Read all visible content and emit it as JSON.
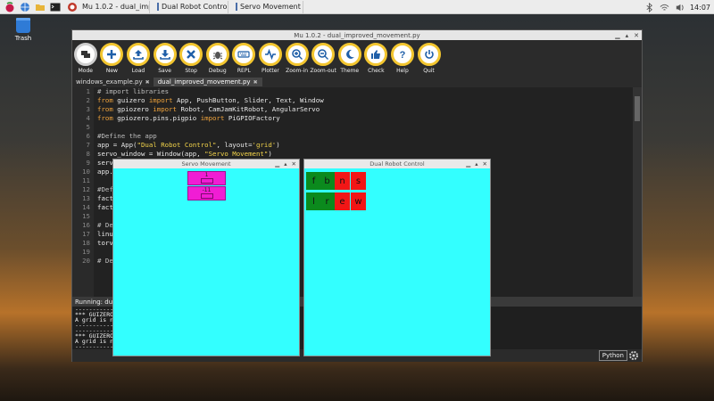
{
  "taskbar": {
    "tasks": [
      {
        "label": "Mu 1.0.2 - dual_impr..."
      },
      {
        "label": "Dual Robot Control"
      },
      {
        "label": "Servo Movement"
      }
    ],
    "clock": "14:07"
  },
  "desktop": {
    "trash_label": "Trash"
  },
  "mu": {
    "title": "Mu 1.0.2 - dual_improved_movement.py",
    "toolbar": [
      {
        "label": "Mode",
        "icon": "mode-icon"
      },
      {
        "label": "New",
        "icon": "plus-icon"
      },
      {
        "label": "Load",
        "icon": "upload-icon"
      },
      {
        "label": "Save",
        "icon": "download-icon"
      },
      {
        "label": "Stop",
        "icon": "close-icon"
      },
      {
        "label": "Debug",
        "icon": "bug-icon"
      },
      {
        "label": "REPL",
        "icon": "keyboard-icon"
      },
      {
        "label": "Plotter",
        "icon": "pulse-icon"
      },
      {
        "label": "Zoom-in",
        "icon": "zoom-in-icon"
      },
      {
        "label": "Zoom-out",
        "icon": "zoom-out-icon"
      },
      {
        "label": "Theme",
        "icon": "moon-icon"
      },
      {
        "label": "Check",
        "icon": "thumbs-up-icon"
      },
      {
        "label": "Help",
        "icon": "question-icon"
      },
      {
        "label": "Quit",
        "icon": "power-icon"
      }
    ],
    "tabs": [
      {
        "label": "windows_example.py"
      },
      {
        "label": "dual_improved_movement.py",
        "active": true
      }
    ],
    "line_numbers": [
      "1",
      "2",
      "3",
      "4",
      "5",
      "6",
      "7",
      "8",
      "9",
      "10",
      "11",
      "12",
      "13",
      "14",
      "15",
      "16",
      "17",
      "18",
      "19",
      "20"
    ],
    "code": {
      "l1": "# import libraries",
      "l2_kw1": "from",
      "l2_a": " guizero ",
      "l2_kw2": "import",
      "l2_b": " App, PushButton, Slider, Text, Window",
      "l3_kw1": "from",
      "l3_a": " gpiozero ",
      "l3_kw2": "import",
      "l3_b": " Robot, CamJamKitRobot, AngularServo",
      "l4_kw1": "from",
      "l4_a": " gpiozero.pins.pigpio ",
      "l4_kw2": "import",
      "l4_b": " PiGPIOFactory",
      "l6": "#Define the app",
      "l7_a": "app = App(",
      "l7_s1": "\"Dual Robot Control\"",
      "l7_b": ", layout=",
      "l7_s2": "'grid'",
      "l7_c": ")",
      "l8_a": "servo_window = Window(app, ",
      "l8_s": "\"Servo Movement\"",
      "l8_b": ")",
      "l9": "servo",
      "l10": "app.",
      "l12": "#Def",
      "l13": "facto",
      "l14": "facto",
      "l16": "# De",
      "l17": "linus",
      "l18": "torva",
      "l20": "# De"
    },
    "repl_header": "Running: dual",
    "repl_lines": [
      "-----------",
      "*** GUIZERO",
      "A grid is n",
      "-----------",
      "-----------",
      "*** GUIZERO",
      "A grid is n",
      "-----------"
    ],
    "mode": "Python"
  },
  "servo_window": {
    "title": "Servo Movement",
    "sliders": [
      {
        "value": "1"
      },
      {
        "value": "-11"
      }
    ]
  },
  "dual_window": {
    "title": "Dual Robot Control",
    "buttons_row1": [
      {
        "label": "f",
        "color": "#0b8a1d"
      },
      {
        "label": "b",
        "color": "#0b8a1d"
      },
      {
        "label": "n",
        "color": "#f21616"
      },
      {
        "label": "s",
        "color": "#f21616"
      }
    ],
    "buttons_row2": [
      {
        "label": "l",
        "color": "#0b8a1d"
      },
      {
        "label": "r",
        "color": "#0b8a1d"
      },
      {
        "label": "e",
        "color": "#f21616"
      },
      {
        "label": "w",
        "color": "#f21616"
      }
    ]
  }
}
